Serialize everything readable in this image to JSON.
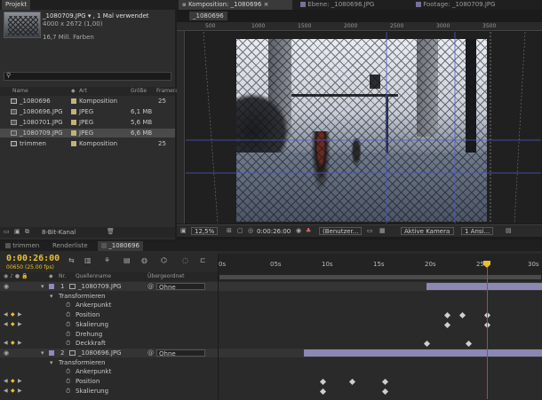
{
  "project": {
    "tab": "Projekt",
    "file_name": "_1080709.JPG ▾ , 1 Mal verwendet",
    "file_dims": "4000 x 2672 (1,00)",
    "file_colors": "16,7 Mill. Farben",
    "search_placeholder": "",
    "columns": {
      "name": "Name",
      "type": "Art",
      "size": "Größe",
      "frame": "Framera"
    },
    "items": [
      {
        "name": "_1080696",
        "type": "Komposition",
        "size": "",
        "frame": "25",
        "kind": "comp",
        "color": "#c2b27a"
      },
      {
        "name": "_1080696.JPG",
        "type": "JPEG",
        "size": "6,1 MB",
        "frame": "",
        "kind": "img",
        "color": "#c2b27a"
      },
      {
        "name": "_1080701.JPG",
        "type": "JPEG",
        "size": "5,6 MB",
        "frame": "",
        "kind": "img",
        "color": "#c2b27a"
      },
      {
        "name": "_1080709.JPG",
        "type": "JPEG",
        "size": "6,6 MB",
        "frame": "",
        "kind": "img",
        "color": "#c2b27a"
      },
      {
        "name": "trimmen",
        "type": "Komposition",
        "size": "",
        "frame": "25",
        "kind": "comp",
        "color": "#c2b27a"
      }
    ],
    "footer_bpc": "8-Bit-Kanal"
  },
  "viewer": {
    "tabs": [
      "Komposition: _1080696",
      "Ebene: _1080696.JPG",
      "Footage: _1080709.JPG"
    ],
    "comp_label": "_1080696",
    "ruler_labels": [
      "500",
      "1000",
      "1500",
      "2000",
      "2500",
      "3000",
      "3500"
    ],
    "zoom": "12,5%",
    "time": "0:00:26:00",
    "resolution": "(Benutzer...",
    "camera": "Aktive Kamera",
    "views": "1 Ansi..."
  },
  "timeline": {
    "tabs": [
      "trimmen",
      "Renderliste",
      "_1080696"
    ],
    "current_time": "0:00:26:00",
    "frame_info": "00650 (25.00 fps)",
    "col_nr": "Nr.",
    "col_source": "Quellenname",
    "col_parent": "Übergeordnet",
    "ruler": [
      "0s",
      "05s",
      "10s",
      "15s",
      "20s",
      "25s",
      "30s"
    ],
    "rows": [
      {
        "type": "layer",
        "nr": "1",
        "name": "_1080709.JPG",
        "parent": "Ohne"
      },
      {
        "type": "group",
        "name": "Transformieren"
      },
      {
        "type": "prop",
        "name": "Ankerpunkt"
      },
      {
        "type": "prop",
        "name": "Position"
      },
      {
        "type": "prop",
        "name": "Skalierung"
      },
      {
        "type": "prop",
        "name": "Drehung"
      },
      {
        "type": "prop",
        "name": "Deckkraft"
      },
      {
        "type": "layer",
        "nr": "2",
        "name": "_1080696.JPG",
        "parent": "Ohne"
      },
      {
        "type": "group",
        "name": "Transformieren"
      },
      {
        "type": "prop",
        "name": "Ankerpunkt"
      },
      {
        "type": "prop",
        "name": "Position"
      },
      {
        "type": "prop",
        "name": "Skalierung"
      }
    ]
  }
}
